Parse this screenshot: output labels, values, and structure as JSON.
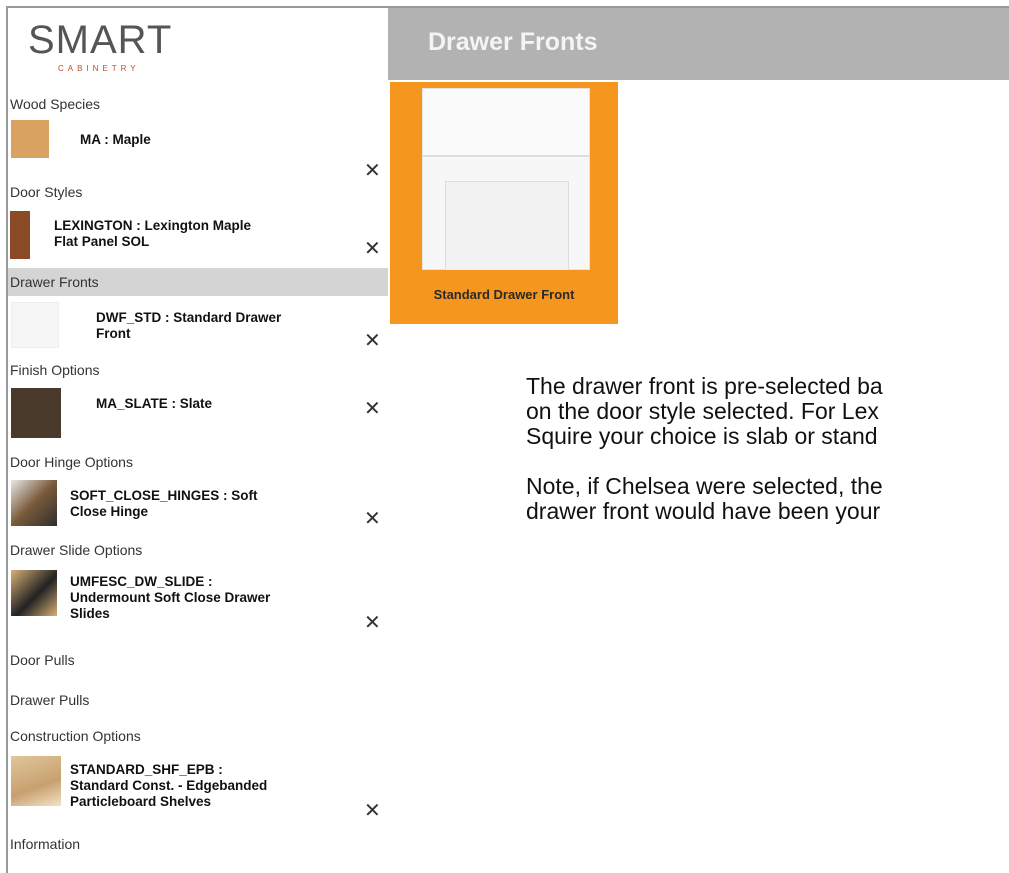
{
  "header": {
    "logo_main": "SMART",
    "logo_sub": "CABINETRY",
    "title": "Drawer Fronts"
  },
  "sidebar": {
    "sections": [
      {
        "label": "Wood Species"
      },
      {
        "label": "Door Styles"
      },
      {
        "label": "Drawer Fronts"
      },
      {
        "label": "Finish Options"
      },
      {
        "label": "Door Hinge Options"
      },
      {
        "label": "Drawer Slide Options"
      },
      {
        "label": "Door Pulls"
      },
      {
        "label": "Drawer Pulls"
      },
      {
        "label": "Construction Options"
      },
      {
        "label": "Information"
      }
    ],
    "items": [
      {
        "line1": "MA : Maple",
        "line2": "",
        "line3": ""
      },
      {
        "line1": "LEXINGTON : Lexington Maple",
        "line2": "Flat Panel SOL",
        "line3": ""
      },
      {
        "line1": "DWF_STD : Standard Drawer",
        "line2": "Front",
        "line3": ""
      },
      {
        "line1": "MA_SLATE : Slate",
        "line2": "",
        "line3": ""
      },
      {
        "line1": "SOFT_CLOSE_HINGES : Soft",
        "line2": "Close Hinge",
        "line3": ""
      },
      {
        "line1": "UMFESC_DW_SLIDE :",
        "line2": "Undermount Soft Close Drawer",
        "line3": "Slides"
      },
      {
        "line1": "STANDARD_SHF_EPB :",
        "line2": "Standard Const. - Edgebanded",
        "line3": "Particleboard Shelves"
      }
    ],
    "remove_glyph": "✕"
  },
  "card": {
    "label": "Standard Drawer Front"
  },
  "note": {
    "lines": [
      "The drawer front is pre-selected ba",
      "on the door style selected. For Lex",
      "Squire your choice is slab or stand",
      "",
      "Note, if Chelsea were selected, the",
      "drawer front would have been your"
    ]
  },
  "colors": {
    "header_bg": "#b2b2b2",
    "accent_orange": "#f5961e",
    "active_section_bg": "#d4d4d4",
    "logo_accent": "#c44a2a"
  }
}
